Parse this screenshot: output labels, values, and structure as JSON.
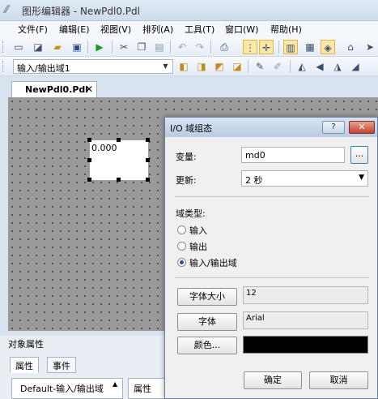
{
  "window": {
    "title": "图形编辑器 - NewPdl0.Pdl"
  },
  "menu": [
    "文件(F)",
    "编辑(E)",
    "视图(V)",
    "排列(A)",
    "工具(T)",
    "窗口(W)",
    "帮助(H)"
  ],
  "toolbar2": {
    "object_combo": "输入/输出域1"
  },
  "document_tab": {
    "label": "NewPdl0.Pdl",
    "close": "✕"
  },
  "canvas": {
    "io_field_value": "0.000"
  },
  "properties_panel": {
    "title": "对象属性",
    "tabs": [
      "属性",
      "事件"
    ],
    "object_list_item": "Default-输入/输出域",
    "attribute_header": "属性"
  },
  "dialog": {
    "title": "I/O 域组态",
    "help_button": "?",
    "close_button": "✕",
    "variable_label": "变量:",
    "variable_value": "md0",
    "browse_button": "...",
    "update_label": "更新:",
    "update_value": "2 秒",
    "field_type_label": "域类型:",
    "field_types": [
      {
        "label": "输入",
        "selected": false
      },
      {
        "label": "输出",
        "selected": false
      },
      {
        "label": "输入/输出域",
        "selected": true
      }
    ],
    "font_size_button": "字体大小",
    "font_size_value": "12",
    "font_button": "字体",
    "font_value": "Arial",
    "color_button": "颜色...",
    "color_value": "#000000",
    "ok_button": "确定",
    "cancel_button": "取消"
  }
}
